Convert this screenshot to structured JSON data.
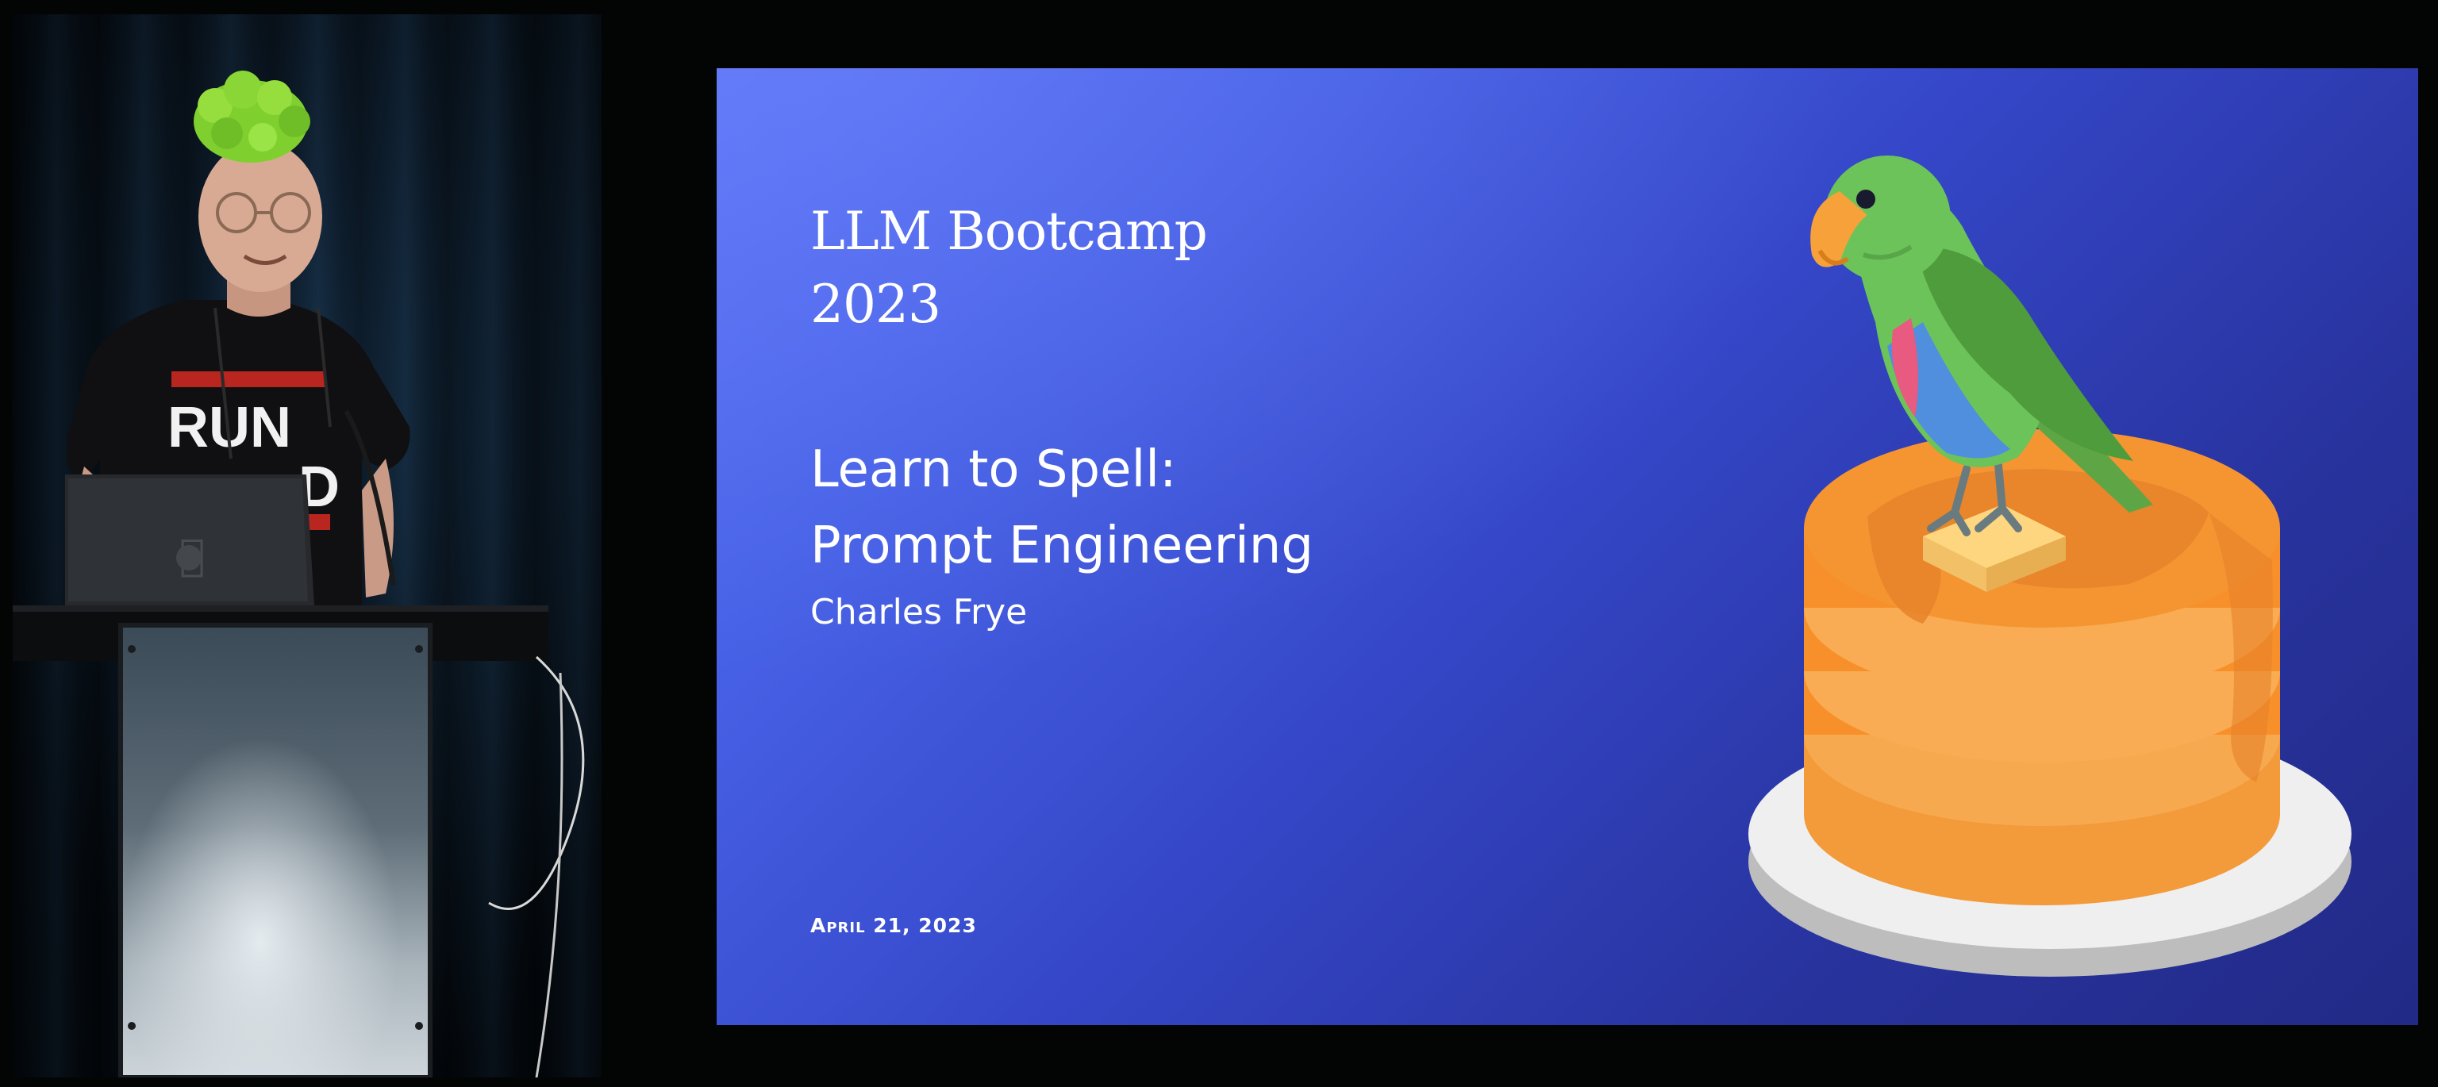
{
  "slide": {
    "course_title": [
      "LLM Bootcamp",
      "2023"
    ],
    "talk_title": [
      "Learn to Spell:",
      "Prompt Engineering"
    ],
    "author": "Charles Frye",
    "date": "April 21, 2023"
  },
  "speaker_panel": {
    "shirt_text": [
      "RUN",
      "D"
    ]
  },
  "colors": {
    "slide_top_left": "#5b74f7",
    "slide_bottom_right": "#222a86",
    "parrot_green": "#6cc35a",
    "pancake_orange": "#f7902a",
    "butter": "#ffd680",
    "plate": "#efefef"
  }
}
